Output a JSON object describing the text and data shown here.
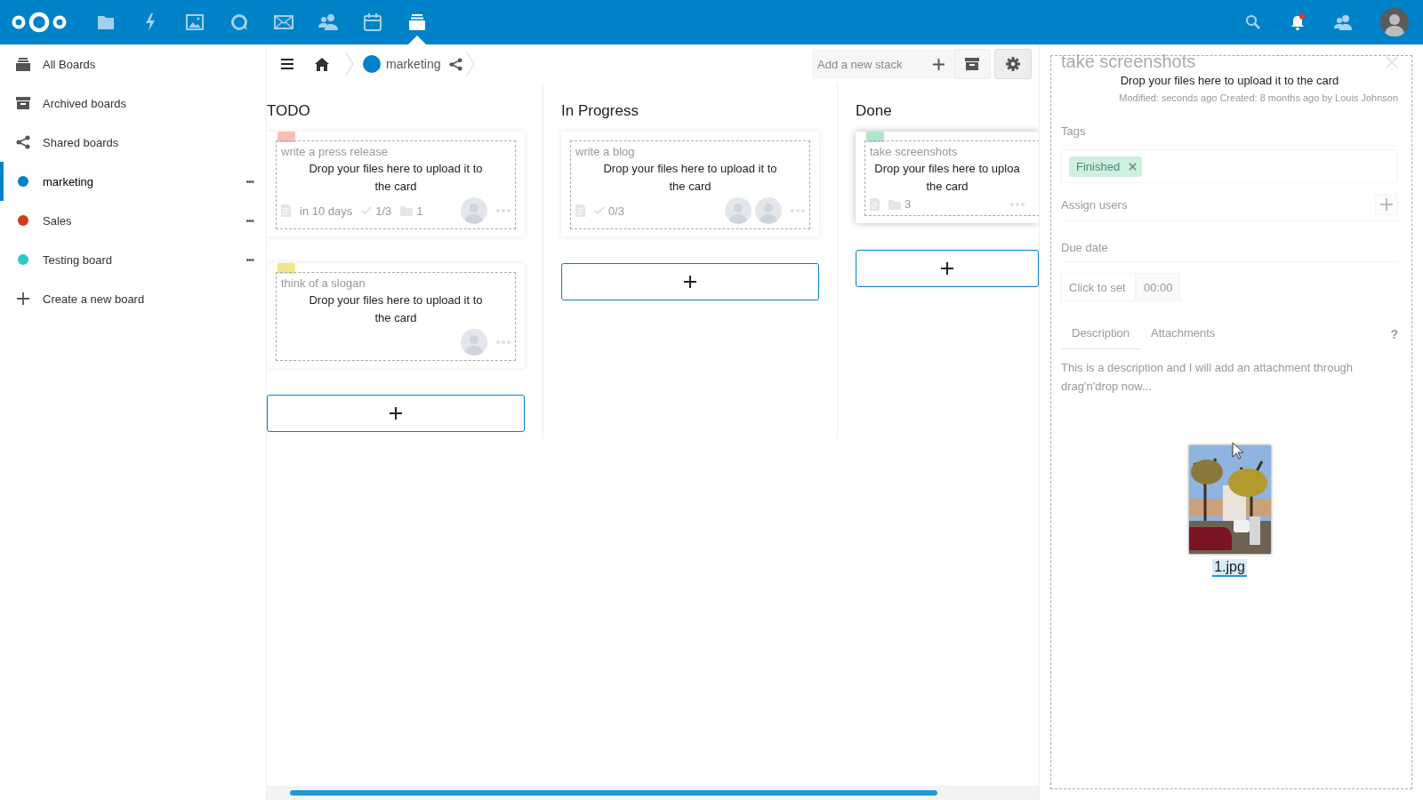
{
  "header": {
    "apps": [
      {
        "kind": "files",
        "selected": false
      },
      {
        "kind": "activity",
        "selected": false
      },
      {
        "kind": "photos",
        "selected": false
      },
      {
        "kind": "talk",
        "selected": false
      },
      {
        "kind": "mail",
        "selected": false
      },
      {
        "kind": "contacts",
        "selected": false
      },
      {
        "kind": "calendar",
        "selected": false
      },
      {
        "kind": "deck",
        "selected": true
      }
    ],
    "notifications": {
      "unread": true
    }
  },
  "sidebar": {
    "items": [
      {
        "kind": "all",
        "label": "All Boards",
        "selected": false
      },
      {
        "kind": "archived",
        "label": "Archived boards",
        "selected": false
      },
      {
        "kind": "shared",
        "label": "Shared boards",
        "selected": false
      },
      {
        "kind": "board",
        "label": "marketing",
        "color": "#0082c9",
        "selected": true,
        "menu": "•••"
      },
      {
        "kind": "board",
        "label": "Sales",
        "color": "#d33b16",
        "selected": false,
        "menu": "•••"
      },
      {
        "kind": "board",
        "label": "Testing board",
        "color": "#2cc9c5",
        "selected": false,
        "menu": "•••"
      },
      {
        "kind": "create",
        "label": "Create a new board",
        "selected": false
      }
    ]
  },
  "toolbar": {
    "board": {
      "title": "marketing",
      "color": "#0082c9"
    },
    "stack_input": {
      "placeholder": "Add a new stack"
    },
    "buttons": [
      {
        "kind": "archive",
        "selected": false
      },
      {
        "kind": "settings",
        "selected": true
      }
    ]
  },
  "stacks": [
    {
      "title": "TODO",
      "cards": [
        {
          "title": "write a press release",
          "color": "#f9bfb5",
          "has_description": true,
          "due": "in 10 days",
          "checklist": "1/3",
          "attachments": "1",
          "assignees": [
            {
              "kind": "avatar"
            }
          ],
          "drop_text": "Drop your files here to upload it to\nthe card",
          "lifted": false
        },
        {
          "title": "think of a slogan",
          "color": "#f3e68a",
          "has_description": false,
          "assignees": [
            {
              "kind": "avatar"
            }
          ],
          "drop_text": "Drop your files here to upload it to\nthe card",
          "lifted": false
        }
      ]
    },
    {
      "title": "In Progress",
      "cards": [
        {
          "title": "write a blog",
          "has_description": true,
          "checklist": "0/3",
          "assignees": [
            {
              "kind": "avatar"
            },
            {
              "kind": "avatar"
            }
          ],
          "drop_text": "Drop your files here to upload it to\nthe card",
          "lifted": false
        }
      ]
    },
    {
      "title": "Done",
      "cards": [
        {
          "title": "take screenshots",
          "color": "#ade6c9",
          "has_description": true,
          "attachments": "3",
          "drop_text": "Drop your files here to uploa\nthe card",
          "lifted": true
        }
      ]
    }
  ],
  "details": {
    "title": "take screenshots",
    "drop_text": "Drop your files here to upload it to the card",
    "meta": "Modified: seconds ago Created: 8 months ago by Louis Johnson",
    "tags_label": "Tags",
    "tags": [
      {
        "label": "Finished",
        "color": "#cdf0df"
      }
    ],
    "assign_label": "Assign users",
    "due_label": "Due date",
    "due_date": {
      "placeholder": "Click to set"
    },
    "due_time": {
      "placeholder": "00:00"
    },
    "tabs": [
      {
        "label": "Description",
        "selected": true
      },
      {
        "label": "Attachments",
        "selected": false
      }
    ],
    "help": "?",
    "description": "This is a description and I will add an attachment through drag'n'drop now...",
    "attachment": {
      "kind": "picture",
      "filename": "1.jpg"
    }
  }
}
